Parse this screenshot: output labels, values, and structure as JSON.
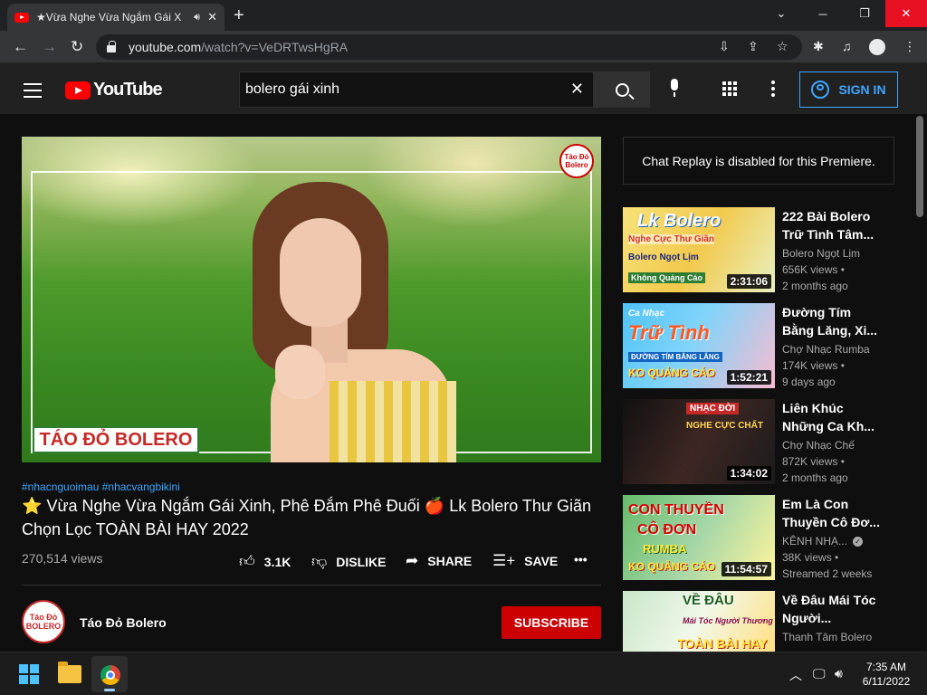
{
  "browser": {
    "tab_title": "★Vừa Nghe Vừa Ngắm Gái X",
    "url_host": "youtube.com",
    "url_path": "/watch?v=VeDRTwsHgRA"
  },
  "youtube": {
    "logo_text": "YouTube",
    "search_query": "bolero gái xinh",
    "sign_in_label": "SIGN IN"
  },
  "video": {
    "overlay_brand": "TÁO ĐỎ BOLERO",
    "badge_text": "Táo Đỏ Bolero",
    "tags": "#nhacnguoimau #nhacvangbikini",
    "title_star": "⭐",
    "title_part1": "Vừa Nghe Vừa Ngắm Gái Xinh, Phê Đắm Phê Đuối",
    "title_apple": "🍎",
    "title_part2": "Lk Bolero Thư Giãn Chọn Lọc TOÀN BÀI HAY 2022",
    "views": "270,514 views",
    "like_count": "3.1K",
    "dislike_label": "DISLIKE",
    "share_label": "SHARE",
    "save_label": "SAVE"
  },
  "channel": {
    "name": "Táo Đỏ Bolero",
    "avatar_text": "Táo Đỏ BOLERO",
    "subscribe_label": "SUBSCRIBE"
  },
  "sidebar": {
    "chat_replay": "Chat Replay is disabled for this Premiere.",
    "recommendations": [
      {
        "title": "222 Bài Bolero Trữ Tình Tâm...",
        "channel": "Bolero Ngọt Lịm",
        "meta1": "656K views •",
        "meta2": "2 months ago",
        "duration": "2:31:06",
        "thumb_line1": "Lk Bolero",
        "thumb_line2": "Nghe Cực Thư Giãn",
        "thumb_line3": "Bolero Ngọt Lịm",
        "thumb_line4": "Không Quảng Cáo"
      },
      {
        "title": "Đường Tím Bằng Lăng, Xi...",
        "channel": "Chợ Nhạc Rumba",
        "meta1": "174K views •",
        "meta2": "9 days ago",
        "duration": "1:52:21",
        "thumb_line1": "Ca Nhạc",
        "thumb_line2": "Trữ Tình",
        "thumb_line3": "ĐƯỜNG TÍM BẰNG LĂNG",
        "thumb_line4": "KO QUẢNG CÁO"
      },
      {
        "title": "Liên Khúc Những Ca Kh...",
        "channel": "Chợ Nhạc Chế",
        "meta1": "872K views •",
        "meta2": "2 months ago",
        "duration": "1:34:02",
        "thumb_line1": "NHẠC ĐỜI",
        "thumb_line2": "NGHE CỰC CHẤT"
      },
      {
        "title": "Em Là Con Thuyền Cô Đơ...",
        "channel": "KÊNH NHẠ...",
        "meta1": "38K views •",
        "meta2": "Streamed 2 weeks",
        "duration": "11:54:57",
        "thumb_line1": "CON THUYỀN",
        "thumb_line2": "CÔ ĐƠN",
        "thumb_line3": "RUMBA",
        "thumb_line4": "KO QUẢNG CÁO"
      },
      {
        "title": "Về Đâu Mái Tóc Người...",
        "channel": "Thanh Tâm Bolero",
        "thumb_line1": "VỀ ĐÂU",
        "thumb_line2": "Mái Tóc Người Thương",
        "thumb_line3": "TOÀN BÀI HAY"
      }
    ]
  },
  "taskbar": {
    "time": "7:35 AM",
    "date": "6/11/2022"
  },
  "colors": {
    "yt_red": "#ff0000",
    "link_blue": "#3ea6ff",
    "subscribe_red": "#cc0000",
    "close_red": "#e81123"
  }
}
